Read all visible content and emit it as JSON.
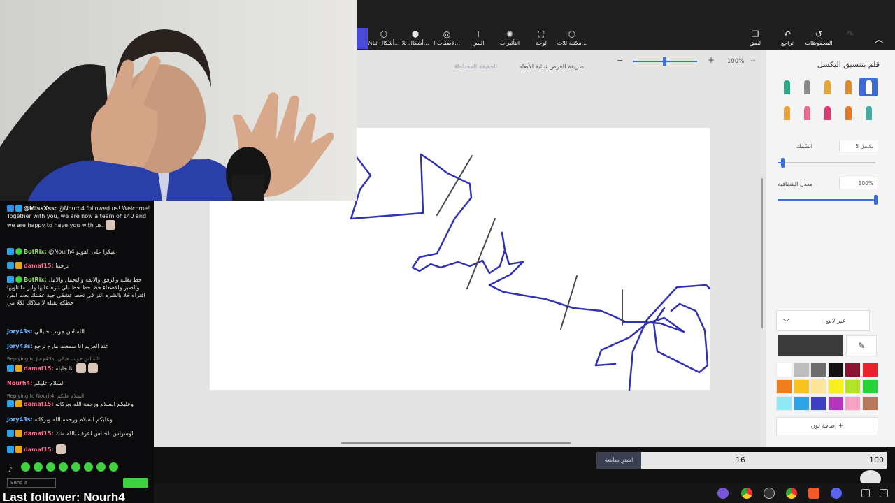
{
  "ribbon": {
    "tools": [
      {
        "label": "مكتبة ثلاث...",
        "icon": "library-3d-icon"
      },
      {
        "label": "لوحة",
        "icon": "canvas-icon"
      },
      {
        "label": "التأثيرات",
        "icon": "effects-icon"
      },
      {
        "label": "النص",
        "icon": "text-icon"
      },
      {
        "label": "لاصقات ا...",
        "icon": "stickers-icon"
      },
      {
        "label": "أشكال ثلا...",
        "icon": "shapes-3d-icon"
      },
      {
        "label": "أشكال ثنائ...",
        "icon": "shapes-2d-icon"
      }
    ],
    "right_tools": [
      {
        "label": "المحفوظات",
        "icon": "history-icon"
      },
      {
        "label": "تراجع",
        "icon": "undo-icon"
      },
      {
        "label": "لصق",
        "icon": "paste-icon"
      }
    ]
  },
  "workspace_bar": {
    "view_mode": "طريقة العرض ثنائية الأبعاد",
    "mixed_reality": "الحقيقة المختلطة",
    "zoom_pct": "100%",
    "zoom_level": 0.47,
    "minus": "−",
    "plus": "+",
    "more": "···"
  },
  "drawing": {
    "blue_color": "#3131b4",
    "dark_color": "#4a4a4a"
  },
  "panel": {
    "title": "قلم بتنسيق البكسل",
    "thickness_label": "السُمك",
    "thickness_value": "5 بكسل",
    "thickness_level": 0.05,
    "opacity_label": "معدل الشفافية",
    "opacity_value": "100%",
    "opacity_level": 1.0,
    "finish": "غير لامع",
    "add_color": "إضافة لون",
    "add_icon": "+",
    "current_color": "#3a3a3a",
    "brushes": [
      {
        "name": "marker",
        "color": "#2aa886"
      },
      {
        "name": "calligraphy-pen",
        "color": "#8a8a8a"
      },
      {
        "name": "oil-brush",
        "color": "#e0a63a"
      },
      {
        "name": "watercolor",
        "color": "#e08a2e"
      },
      {
        "name": "pixel-pen",
        "color": "#ffffff"
      },
      {
        "name": "pencil",
        "color": "#e7a03b"
      },
      {
        "name": "eraser",
        "color": "#e46c8c"
      },
      {
        "name": "crayon",
        "color": "#d93b6c"
      },
      {
        "name": "spray-can",
        "color": "#e27a2a"
      },
      {
        "name": "fill",
        "color": "#4aa8a0"
      }
    ],
    "colors": [
      "#ffffff",
      "#bdbdbd",
      "#6e6e6e",
      "#111111",
      "#8b1330",
      "#e8222d",
      "#ef7d1e",
      "#f6c21b",
      "#fbe69a",
      "#f7f01e",
      "#b4e329",
      "#27d23a",
      "#8fe8f4",
      "#2ca3e6",
      "#3d3fc4",
      "#b535b9",
      "#f5a2c5",
      "#b5785a"
    ]
  },
  "statusbar": {
    "badge": "اشترِ شاشة",
    "value_a": "16",
    "value_b": "100"
  },
  "chat": {
    "messages": [
      {
        "user": "@MissXss:",
        "user_color": "#ffffff",
        "text": " @Nourh4 followed us! Welcome! Together with you, we are now a team of 140 and we are happy to have you with us."
      },
      {
        "user": "BotRix:",
        "user_color": "#9be36b",
        "text": " @Nourh4 شكرا على الفولو"
      },
      {
        "user": "damaf15:",
        "user_color": "#ff6b8b",
        "text": " ترحيبا"
      },
      {
        "user": "BotRix:",
        "user_color": "#9be36b",
        "text": " حظ بقلبه والرفق والالفه والتحمل والامل والصبر والاصغاء حظ حظ حظ بلي ناره عليها واير ما ناويها افتراه خلا بالشره التر في تحط عشقي جيد عقلتك بعت الفن حظكه يقبله لا ملاكك لكلا مي"
      },
      {
        "user": "Jory43s:",
        "user_color": "#6cb7ff",
        "text": " الله اس جويب حبيالي"
      },
      {
        "user": "Jory43s:",
        "user_color": "#6cb7ff",
        "text": " عند العزيم انا سمعت مارح نرجع"
      },
      {
        "user": "damaf15:",
        "user_color": "#ff6b8b",
        "text": " انا جلبله",
        "reply": "Replying to Jory43s: الله اس جويب حبالي"
      },
      {
        "user": "Nourh4:",
        "user_color": "#ff6b8b",
        "text": " السلام عليكم"
      },
      {
        "user": "damaf15:",
        "user_color": "#ff6b8b",
        "text": " وعليكم السلام ورحمة الله وبركاته",
        "reply": "Replying to Nourh4: السلام عليكم"
      },
      {
        "user": "Jory43s:",
        "user_color": "#6cb7ff",
        "text": " وعليكم السلام ورحمه الله وبركاته"
      },
      {
        "user": "damaf15:",
        "user_color": "#ff6b8b",
        "text": " الوسواس الخناس اعرف بالله منك"
      },
      {
        "user": "damaf15:",
        "user_color": "#ff6b8b",
        "text": ""
      }
    ],
    "input_placeholder": "Send a",
    "last_follower": "Last follower: Nourh4"
  }
}
